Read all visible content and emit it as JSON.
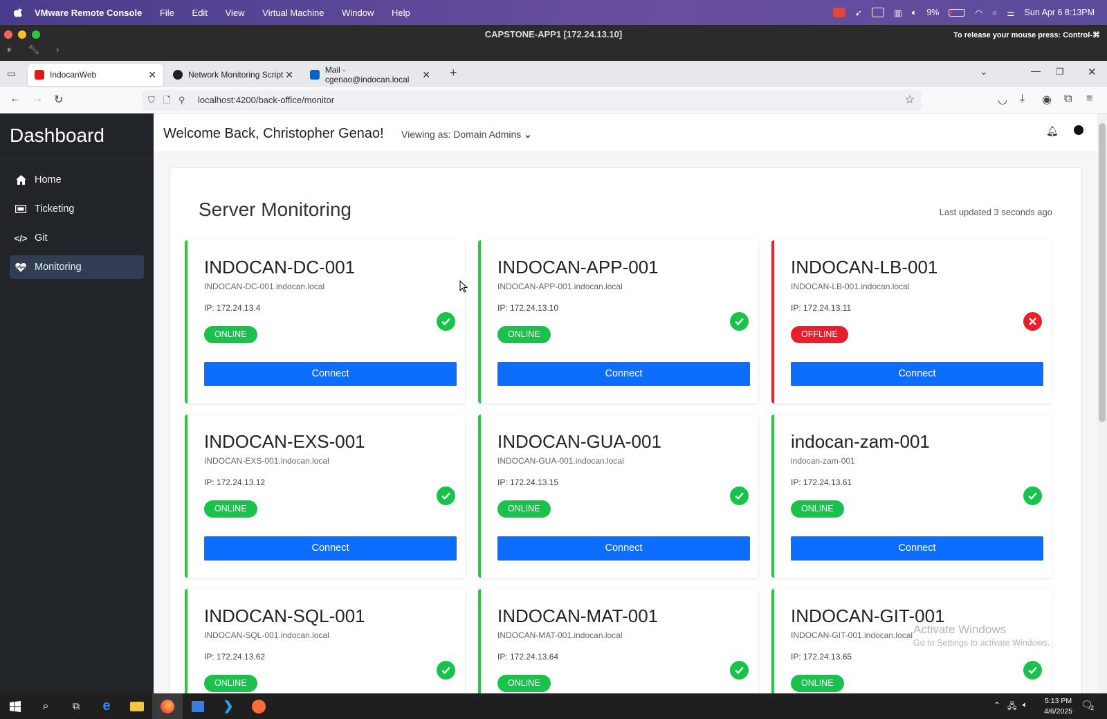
{
  "mac": {
    "app_name": "VMware Remote Console",
    "menus": [
      "File",
      "Edit",
      "View",
      "Virtual Machine",
      "Window",
      "Help"
    ],
    "battery": "9%",
    "datetime": "Sun Apr 6  8:13PM"
  },
  "vm": {
    "title": "CAPSTONE-APP1 [172.24.13.10]",
    "release_hint": "To release your mouse press: Control-⌘"
  },
  "browser": {
    "tabs": [
      {
        "label": "IndocanWeb"
      },
      {
        "label": "Network Monitoring Script"
      },
      {
        "label": "Mail - cgenao@indocan.local"
      }
    ],
    "url": "localhost:4200/back-office/monitor"
  },
  "sidebar": {
    "brand": "Dashboard",
    "items": [
      {
        "label": "Home",
        "icon": "home-icon"
      },
      {
        "label": "Ticketing",
        "icon": "ticket-icon"
      },
      {
        "label": "Git",
        "icon": "code-icon"
      },
      {
        "label": "Monitoring",
        "icon": "heart-pulse-icon"
      }
    ]
  },
  "header": {
    "welcome": "Welcome Back, Christopher Genao!",
    "viewing_as": "Viewing as: Domain Admins"
  },
  "monitor": {
    "title": "Server Monitoring",
    "last_updated": "Last updated 3 seconds ago",
    "connect_label": "Connect",
    "servers": [
      {
        "name": "INDOCAN-DC-001",
        "fqdn": "INDOCAN-DC-001.indocan.local",
        "ip": "IP: 172.24.13.4",
        "status": "ONLINE"
      },
      {
        "name": "INDOCAN-APP-001",
        "fqdn": "INDOCAN-APP-001.indocan.local",
        "ip": "IP: 172.24.13.10",
        "status": "ONLINE"
      },
      {
        "name": "INDOCAN-LB-001",
        "fqdn": "INDOCAN-LB-001.indocan.local",
        "ip": "IP: 172.24.13.11",
        "status": "OFFLINE"
      },
      {
        "name": "INDOCAN-EXS-001",
        "fqdn": "INDOCAN-EXS-001.indocan.local",
        "ip": "IP: 172.24.13.12",
        "status": "ONLINE"
      },
      {
        "name": "INDOCAN-GUA-001",
        "fqdn": "INDOCAN-GUA-001.indocan.local",
        "ip": "IP: 172.24.13.15",
        "status": "ONLINE"
      },
      {
        "name": "indocan-zam-001",
        "fqdn": "indocan-zam-001",
        "ip": "IP: 172.24.13.61",
        "status": "ONLINE"
      },
      {
        "name": "INDOCAN-SQL-001",
        "fqdn": "INDOCAN-SQL-001.indocan.local",
        "ip": "IP: 172.24.13.62",
        "status": "ONLINE"
      },
      {
        "name": "INDOCAN-MAT-001",
        "fqdn": "INDOCAN-MAT-001.indocan.local",
        "ip": "IP: 172.24.13.64",
        "status": "ONLINE"
      },
      {
        "name": "INDOCAN-GIT-001",
        "fqdn": "INDOCAN-GIT-001.indocan.local",
        "ip": "IP: 172.24.13.65",
        "status": "ONLINE"
      }
    ]
  },
  "watermark": {
    "line1": "Activate Windows",
    "line2": "Go to Settings to activate Windows."
  },
  "taskbar": {
    "time": "5:13 PM",
    "date": "4/6/2025",
    "notifications": "2"
  },
  "colors": {
    "online": "#19c24b",
    "offline": "#ea1f2c",
    "primary": "#0d6efd",
    "sidebar_bg": "#212529"
  }
}
